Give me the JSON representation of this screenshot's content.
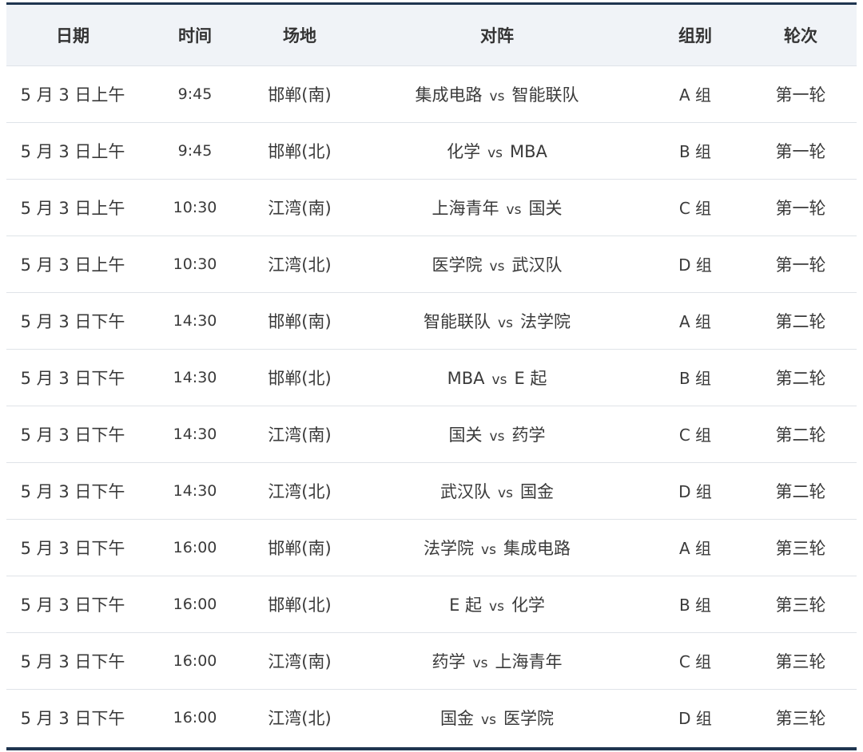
{
  "table": {
    "headers": {
      "date": "日期",
      "time": "时间",
      "venue": "场地",
      "matchup": "对阵",
      "group": "组别",
      "round": "轮次"
    },
    "vs_label": "vs",
    "rows": [
      {
        "date": "5 月 3 日上午",
        "time": "9:45",
        "venue": "邯郸(南)",
        "home": "集成电路",
        "away": "智能联队",
        "group": "A 组",
        "round": "第一轮"
      },
      {
        "date": "5 月 3 日上午",
        "time": "9:45",
        "venue": "邯郸(北)",
        "home": "化学",
        "away": "MBA",
        "group": "B 组",
        "round": "第一轮"
      },
      {
        "date": "5 月 3 日上午",
        "time": "10:30",
        "venue": "江湾(南)",
        "home": "上海青年",
        "away": "国关",
        "group": "C 组",
        "round": "第一轮"
      },
      {
        "date": "5 月 3 日上午",
        "time": "10:30",
        "venue": "江湾(北)",
        "home": "医学院",
        "away": "武汉队",
        "group": "D 组",
        "round": "第一轮"
      },
      {
        "date": "5 月 3 日下午",
        "time": "14:30",
        "venue": "邯郸(南)",
        "home": "智能联队",
        "away": "法学院",
        "group": "A 组",
        "round": "第二轮"
      },
      {
        "date": "5 月 3 日下午",
        "time": "14:30",
        "venue": "邯郸(北)",
        "home": "MBA",
        "away": "E 起",
        "group": "B 组",
        "round": "第二轮"
      },
      {
        "date": "5 月 3 日下午",
        "time": "14:30",
        "venue": "江湾(南)",
        "home": "国关",
        "away": "药学",
        "group": "C 组",
        "round": "第二轮"
      },
      {
        "date": "5 月 3 日下午",
        "time": "14:30",
        "venue": "江湾(北)",
        "home": "武汉队",
        "away": "国金",
        "group": "D 组",
        "round": "第二轮"
      },
      {
        "date": "5 月 3 日下午",
        "time": "16:00",
        "venue": "邯郸(南)",
        "home": "法学院",
        "away": "集成电路",
        "group": "A 组",
        "round": "第三轮"
      },
      {
        "date": "5 月 3 日下午",
        "time": "16:00",
        "venue": "邯郸(北)",
        "home": "E 起",
        "away": "化学",
        "group": "B 组",
        "round": "第三轮"
      },
      {
        "date": "5 月 3 日下午",
        "time": "16:00",
        "venue": "江湾(南)",
        "home": "药学",
        "away": "上海青年",
        "group": "C 组",
        "round": "第三轮"
      },
      {
        "date": "5 月 3 日下午",
        "time": "16:00",
        "venue": "江湾(北)",
        "home": "国金",
        "away": "医学院",
        "group": "D 组",
        "round": "第三轮"
      }
    ]
  }
}
